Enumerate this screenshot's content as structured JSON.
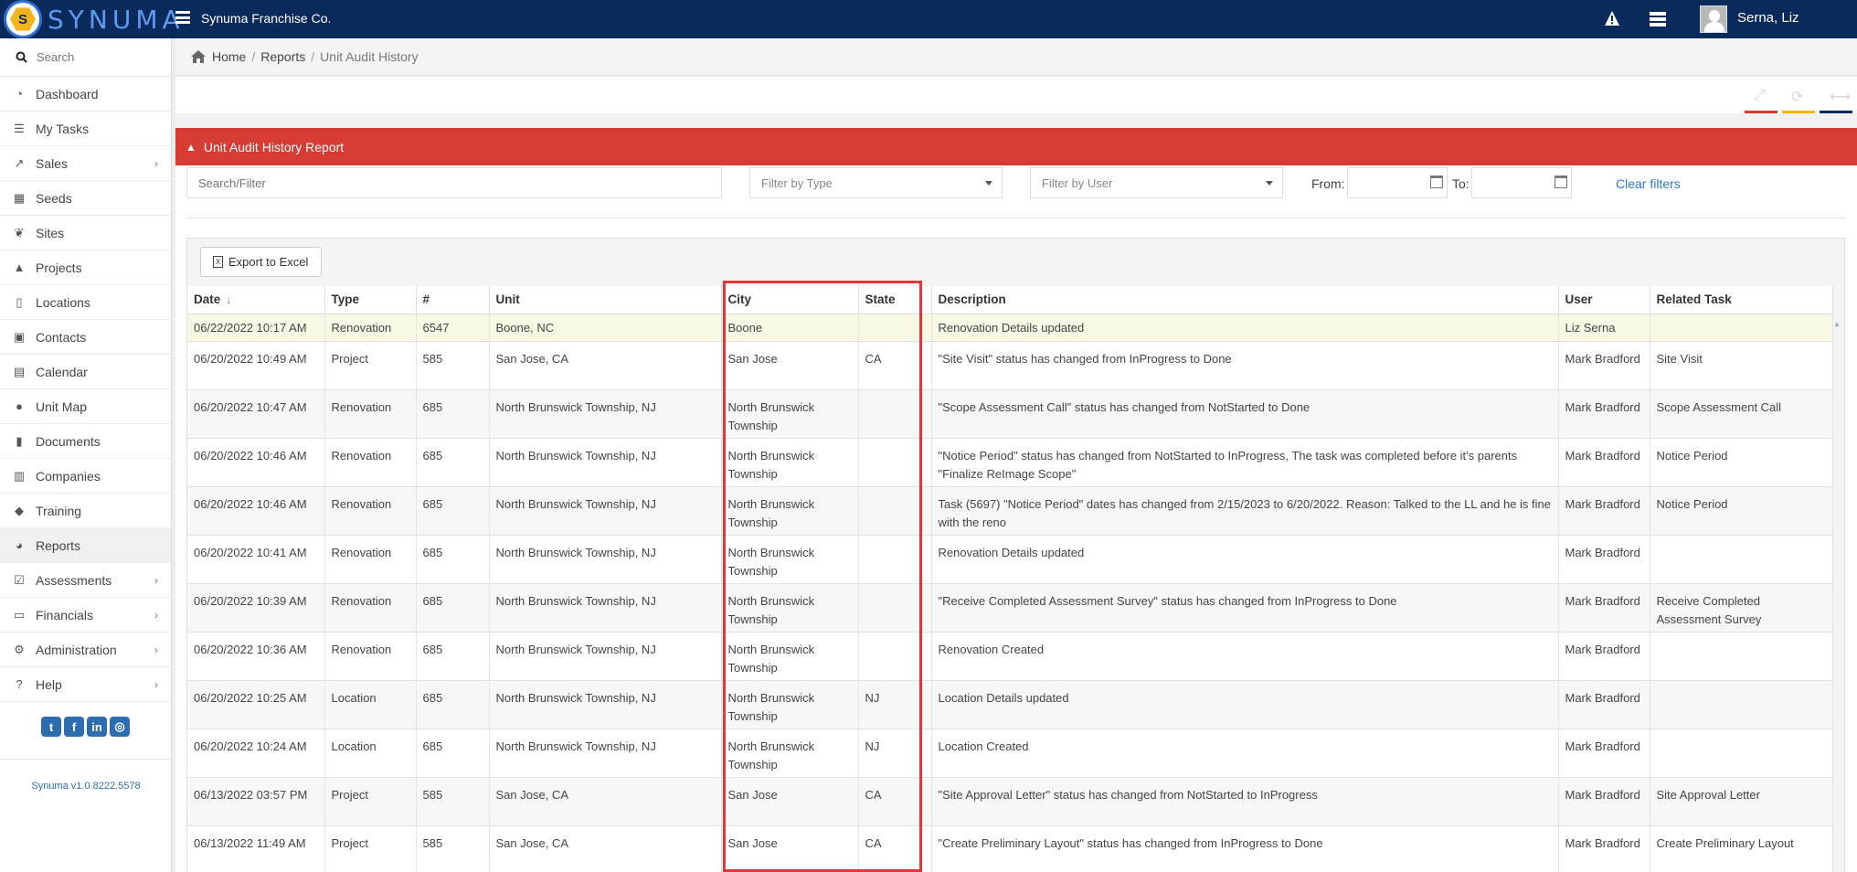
{
  "app": {
    "logo_text": "SYNUMA",
    "company": "Synuma Franchise Co.",
    "user_name": "Serna, Liz",
    "brand_color": "#0b2a5c",
    "accent_color": "#d63c34"
  },
  "sidebar": {
    "search_placeholder": "Search",
    "items": [
      {
        "label": "Dashboard",
        "icon": "dashboard-icon"
      },
      {
        "label": "My Tasks",
        "icon": "tasks-icon"
      },
      {
        "label": "Sales",
        "icon": "chart-line-icon",
        "has_submenu": true
      },
      {
        "label": "Seeds",
        "icon": "grid-icon"
      },
      {
        "label": "Sites",
        "icon": "leaf-icon"
      },
      {
        "label": "Projects",
        "icon": "road-icon"
      },
      {
        "label": "Locations",
        "icon": "building-icon"
      },
      {
        "label": "Contacts",
        "icon": "address-book-icon"
      },
      {
        "label": "Calendar",
        "icon": "calendar-icon"
      },
      {
        "label": "Unit Map",
        "icon": "globe-icon"
      },
      {
        "label": "Documents",
        "icon": "file-icon"
      },
      {
        "label": "Companies",
        "icon": "company-icon"
      },
      {
        "label": "Training",
        "icon": "graduation-cap-icon"
      },
      {
        "label": "Reports",
        "icon": "pie-chart-icon",
        "active": true
      },
      {
        "label": "Assessments",
        "icon": "check-square-icon",
        "has_submenu": true
      },
      {
        "label": "Financials",
        "icon": "money-icon",
        "has_submenu": true
      },
      {
        "label": "Administration",
        "icon": "cogs-icon",
        "has_submenu": true
      },
      {
        "label": "Help",
        "icon": "question-icon",
        "has_submenu": true
      }
    ],
    "socials": [
      "twitter-icon",
      "facebook-icon",
      "linkedin-icon",
      "instagram-icon"
    ],
    "version": "Synuma v1.0.8222.5578"
  },
  "breadcrumb": {
    "home": "Home",
    "reports": "Reports",
    "current": "Unit Audit History"
  },
  "panel": {
    "title": "Unit Audit History Report"
  },
  "filters": {
    "search_placeholder": "Search/Filter",
    "type_placeholder": "Filter by Type",
    "user_placeholder": "Filter by User",
    "from_label": "From:",
    "to_label": "To:",
    "clear_label": "Clear filters"
  },
  "export": {
    "label": "Export to Excel"
  },
  "table": {
    "columns": [
      "Date",
      "Type",
      "#",
      "Unit",
      "City",
      "State",
      "Description",
      "User",
      "Related Task"
    ],
    "sort_column": "Date",
    "sort_direction": "descending",
    "rows": [
      [
        "06/22/2022 10:17 AM",
        "Renovation",
        "6547",
        "Boone, NC",
        "Boone",
        "",
        "Renovation Details updated",
        "Liz Serna",
        ""
      ],
      [
        "06/20/2022 10:49 AM",
        "Project",
        "585",
        "San Jose, CA",
        "San Jose",
        "CA",
        "\"Site Visit\" status has changed from InProgress to Done",
        "Mark Bradford",
        "Site Visit"
      ],
      [
        "06/20/2022 10:47 AM",
        "Renovation",
        "685",
        "North Brunswick Township, NJ",
        "North Brunswick Township",
        "",
        "\"Scope Assessment Call\" status has changed from NotStarted to Done",
        "Mark Bradford",
        "Scope Assessment Call"
      ],
      [
        "06/20/2022 10:46 AM",
        "Renovation",
        "685",
        "North Brunswick Township, NJ",
        "North Brunswick Township",
        "",
        "\"Notice Period\" status has changed from NotStarted to InProgress, The task was completed before it's parents \"Finalize ReImage Scope\"",
        "Mark Bradford",
        "Notice Period"
      ],
      [
        "06/20/2022 10:46 AM",
        "Renovation",
        "685",
        "North Brunswick Township, NJ",
        "North Brunswick Township",
        "",
        "Task (5697) \"Notice Period\" dates has changed from 2/15/2023 to 6/20/2022. Reason: Talked to the LL and he is fine with the reno",
        "Mark Bradford",
        "Notice Period"
      ],
      [
        "06/20/2022 10:41 AM",
        "Renovation",
        "685",
        "North Brunswick Township, NJ",
        "North Brunswick Township",
        "",
        "Renovation Details updated",
        "Mark Bradford",
        ""
      ],
      [
        "06/20/2022 10:39 AM",
        "Renovation",
        "685",
        "North Brunswick Township, NJ",
        "North Brunswick Township",
        "",
        "\"Receive Completed Assessment Survey\" status has changed from InProgress to Done",
        "Mark Bradford",
        "Receive Completed Assessment Survey"
      ],
      [
        "06/20/2022 10:36 AM",
        "Renovation",
        "685",
        "North Brunswick Township, NJ",
        "North Brunswick Township",
        "",
        "Renovation Created",
        "Mark Bradford",
        ""
      ],
      [
        "06/20/2022 10:25 AM",
        "Location",
        "685",
        "North Brunswick Township, NJ",
        "North Brunswick Township",
        "NJ",
        "Location Details updated",
        "Mark Bradford",
        ""
      ],
      [
        "06/20/2022 10:24 AM",
        "Location",
        "685",
        "North Brunswick Township, NJ",
        "North Brunswick Township",
        "NJ",
        "Location Created",
        "Mark Bradford",
        ""
      ],
      [
        "06/13/2022 03:57 PM",
        "Project",
        "585",
        "San Jose, CA",
        "San Jose",
        "CA",
        "\"Site Approval Letter\" status has changed from NotStarted to InProgress",
        "Mark Bradford",
        "Site Approval Letter"
      ],
      [
        "06/13/2022 11:49 AM",
        "Project",
        "585",
        "San Jose, CA",
        "San Jose",
        "CA",
        "\"Create Preliminary Layout\" status has changed from InProgress to Done",
        "Mark Bradford",
        "Create Preliminary Layout"
      ]
    ]
  }
}
